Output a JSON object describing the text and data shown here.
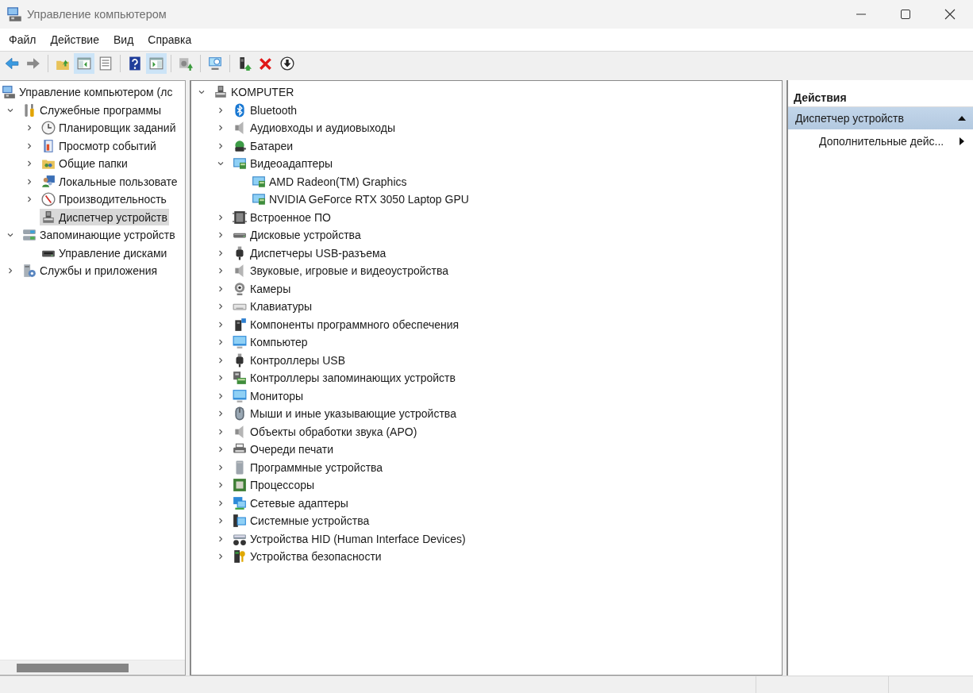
{
  "window": {
    "title": "Управление компьютером"
  },
  "menu": [
    "Файл",
    "Действие",
    "Вид",
    "Справка"
  ],
  "toolbar": [
    {
      "kind": "back",
      "selected": false
    },
    {
      "kind": "forward",
      "selected": false
    },
    {
      "kind": "separator"
    },
    {
      "kind": "up",
      "selected": false
    },
    {
      "kind": "tree-pane",
      "selected": true
    },
    {
      "kind": "properties",
      "selected": false
    },
    {
      "kind": "separator"
    },
    {
      "kind": "help",
      "selected": false
    },
    {
      "kind": "action-pane",
      "selected": true
    },
    {
      "kind": "separator"
    },
    {
      "kind": "export",
      "selected": false
    },
    {
      "kind": "separator"
    },
    {
      "kind": "scan",
      "selected": false
    },
    {
      "kind": "separator"
    },
    {
      "kind": "enable",
      "selected": false
    },
    {
      "kind": "uninstall",
      "selected": false
    },
    {
      "kind": "update",
      "selected": false
    }
  ],
  "console_tree": {
    "root": {
      "label": "Управление компьютером (лс",
      "kind": "computer-management",
      "selected": false
    },
    "items": [
      {
        "label": "Служебные программы",
        "kind": "tools",
        "expanded": true,
        "selected": false,
        "children": [
          {
            "label": "Планировщик заданий",
            "kind": "clock",
            "expanded": false,
            "selected": false
          },
          {
            "label": "Просмотр событий",
            "kind": "event-viewer",
            "expanded": false,
            "selected": false
          },
          {
            "label": "Общие папки",
            "kind": "shared-folder",
            "expanded": false,
            "selected": false
          },
          {
            "label": "Локальные пользовате",
            "kind": "users",
            "expanded": false,
            "selected": false
          },
          {
            "label": "Производительность",
            "kind": "performance",
            "expanded": false,
            "selected": false
          },
          {
            "label": "Диспетчер устройств",
            "kind": "device-manager",
            "selected": true
          }
        ]
      },
      {
        "label": "Запоминающие устройств",
        "kind": "storage",
        "expanded": true,
        "selected": false,
        "children": [
          {
            "label": "Управление дисками",
            "kind": "disk-management",
            "selected": false
          }
        ]
      },
      {
        "label": "Службы и приложения",
        "kind": "services",
        "expanded": false,
        "selected": false
      }
    ]
  },
  "device_tree": {
    "root": {
      "label": "KOMPUTER",
      "kind": "device-manager",
      "expanded": true
    },
    "categories": [
      {
        "label": "Bluetooth",
        "kind": "bluetooth",
        "expanded": false
      },
      {
        "label": "Аудиовходы и аудиовыходы",
        "kind": "speaker",
        "expanded": false
      },
      {
        "label": "Батареи",
        "kind": "battery",
        "expanded": false
      },
      {
        "label": "Видеоадаптеры",
        "kind": "display-adapter",
        "expanded": true,
        "children": [
          {
            "label": "AMD Radeon(TM) Graphics",
            "kind": "display-adapter"
          },
          {
            "label": "NVIDIA GeForce RTX 3050 Laptop GPU",
            "kind": "display-adapter"
          }
        ]
      },
      {
        "label": "Встроенное ПО",
        "kind": "firmware",
        "expanded": false
      },
      {
        "label": "Дисковые устройства",
        "kind": "disk",
        "expanded": false
      },
      {
        "label": "Диспетчеры USB-разъема",
        "kind": "usb",
        "expanded": false
      },
      {
        "label": "Звуковые, игровые и видеоустройства",
        "kind": "speaker",
        "expanded": false
      },
      {
        "label": "Камеры",
        "kind": "camera",
        "expanded": false
      },
      {
        "label": "Клавиатуры",
        "kind": "keyboard",
        "expanded": false
      },
      {
        "label": "Компоненты программного обеспечения",
        "kind": "software-component",
        "expanded": false
      },
      {
        "label": "Компьютер",
        "kind": "monitor",
        "expanded": false
      },
      {
        "label": "Контроллеры USB",
        "kind": "usb",
        "expanded": false
      },
      {
        "label": "Контроллеры запоминающих устройств",
        "kind": "storage-controller",
        "expanded": false
      },
      {
        "label": "Мониторы",
        "kind": "monitor",
        "expanded": false
      },
      {
        "label": "Мыши и иные указывающие устройства",
        "kind": "mouse",
        "expanded": false
      },
      {
        "label": "Объекты обработки звука (APO)",
        "kind": "speaker",
        "expanded": false
      },
      {
        "label": "Очереди печати",
        "kind": "printer",
        "expanded": false
      },
      {
        "label": "Программные устройства",
        "kind": "software-device",
        "expanded": false
      },
      {
        "label": "Процессоры",
        "kind": "processor",
        "expanded": false
      },
      {
        "label": "Сетевые адаптеры",
        "kind": "network",
        "expanded": false
      },
      {
        "label": "Системные устройства",
        "kind": "system",
        "expanded": false
      },
      {
        "label": "Устройства HID (Human Interface Devices)",
        "kind": "hid",
        "expanded": false
      },
      {
        "label": "Устройства безопасности",
        "kind": "security",
        "expanded": false
      }
    ]
  },
  "actions": {
    "title": "Действия",
    "section": {
      "label": "Диспетчер устройств",
      "expanded": true
    },
    "items": [
      {
        "label": "Дополнительные дейс...",
        "has_submenu": true
      }
    ]
  }
}
